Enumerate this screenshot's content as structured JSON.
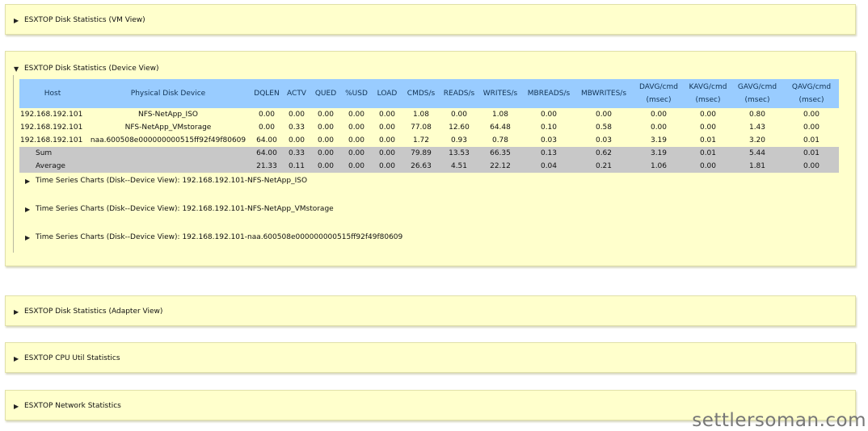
{
  "panels": {
    "vm_view": {
      "title": "ESXTOP Disk Statistics (VM View)",
      "arrow": "▶"
    },
    "device_view": {
      "title": "ESXTOP Disk Statistics (Device View)",
      "arrow": "▼"
    },
    "adapter_view": {
      "title": "ESXTOP Disk Statistics (Adapter View)",
      "arrow": "▶"
    },
    "cpu": {
      "title": "ESXTOP CPU Util Statistics",
      "arrow": "▶"
    },
    "network": {
      "title": "ESXTOP Network Statistics",
      "arrow": "▶"
    }
  },
  "table": {
    "headers": {
      "host": "Host",
      "device": "Physical Disk Device",
      "dqlen": "DQLEN",
      "actv": "ACTV",
      "qued": "QUED",
      "usd": "%USD",
      "load": "LOAD",
      "cmds": "CMDS/s",
      "reads": "READS/s",
      "writes": "WRITES/s",
      "mbreads": "MBREADS/s",
      "mbwrites": "MBWRITES/s",
      "davg": "DAVG/cmd",
      "kavg": "KAVG/cmd",
      "gavg": "GAVG/cmd",
      "qavg": "QAVG/cmd",
      "unit": "(msec)"
    },
    "rows": [
      [
        "192.168.192.101",
        "NFS-NetApp_ISO",
        "0.00",
        "0.00",
        "0.00",
        "0.00",
        "0.00",
        "1.08",
        "0.00",
        "1.08",
        "0.00",
        "0.00",
        "0.00",
        "0.00",
        "0.80",
        "0.00"
      ],
      [
        "192.168.192.101",
        "NFS-NetApp_VMstorage",
        "0.00",
        "0.33",
        "0.00",
        "0.00",
        "0.00",
        "77.08",
        "12.60",
        "64.48",
        "0.10",
        "0.58",
        "0.00",
        "0.00",
        "1.43",
        "0.00"
      ],
      [
        "192.168.192.101",
        "naa.600508e000000000515ff92f49f80609",
        "64.00",
        "0.00",
        "0.00",
        "0.00",
        "0.00",
        "1.72",
        "0.93",
        "0.78",
        "0.03",
        "0.03",
        "3.19",
        "0.01",
        "3.20",
        "0.01"
      ],
      [
        "Sum",
        "",
        "64.00",
        "0.33",
        "0.00",
        "0.00",
        "0.00",
        "79.89",
        "13.53",
        "66.35",
        "0.13",
        "0.62",
        "3.19",
        "0.01",
        "5.44",
        "0.01"
      ],
      [
        "Average",
        "",
        "21.33",
        "0.11",
        "0.00",
        "0.00",
        "0.00",
        "26.63",
        "4.51",
        "22.12",
        "0.04",
        "0.21",
        "1.06",
        "0.00",
        "1.81",
        "0.00"
      ]
    ]
  },
  "charts": {
    "arrow": "▶",
    "items": [
      "Time Series Charts (Disk--Device View): 192.168.192.101-NFS-NetApp_ISO",
      "Time Series Charts (Disk--Device View): 192.168.192.101-NFS-NetApp_VMstorage",
      "Time Series Charts (Disk--Device View): 192.168.192.101-naa.600508e000000000515ff92f49f80609"
    ]
  },
  "watermark": "settlersoman.com"
}
